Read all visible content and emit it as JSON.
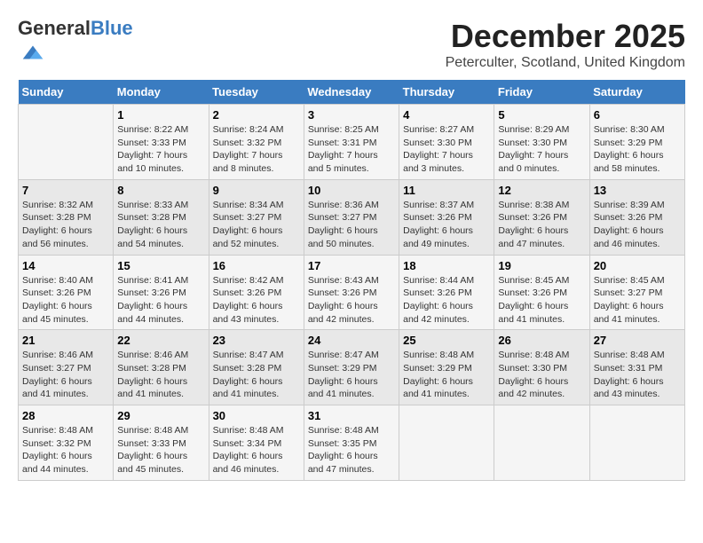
{
  "header": {
    "logo_general": "General",
    "logo_blue": "Blue",
    "month_title": "December 2025",
    "location": "Peterculter, Scotland, United Kingdom"
  },
  "days_of_week": [
    "Sunday",
    "Monday",
    "Tuesday",
    "Wednesday",
    "Thursday",
    "Friday",
    "Saturday"
  ],
  "weeks": [
    [
      {
        "day": "",
        "info": ""
      },
      {
        "day": "1",
        "info": "Sunrise: 8:22 AM\nSunset: 3:33 PM\nDaylight: 7 hours\nand 10 minutes."
      },
      {
        "day": "2",
        "info": "Sunrise: 8:24 AM\nSunset: 3:32 PM\nDaylight: 7 hours\nand 8 minutes."
      },
      {
        "day": "3",
        "info": "Sunrise: 8:25 AM\nSunset: 3:31 PM\nDaylight: 7 hours\nand 5 minutes."
      },
      {
        "day": "4",
        "info": "Sunrise: 8:27 AM\nSunset: 3:30 PM\nDaylight: 7 hours\nand 3 minutes."
      },
      {
        "day": "5",
        "info": "Sunrise: 8:29 AM\nSunset: 3:30 PM\nDaylight: 7 hours\nand 0 minutes."
      },
      {
        "day": "6",
        "info": "Sunrise: 8:30 AM\nSunset: 3:29 PM\nDaylight: 6 hours\nand 58 minutes."
      }
    ],
    [
      {
        "day": "7",
        "info": "Sunrise: 8:32 AM\nSunset: 3:28 PM\nDaylight: 6 hours\nand 56 minutes."
      },
      {
        "day": "8",
        "info": "Sunrise: 8:33 AM\nSunset: 3:28 PM\nDaylight: 6 hours\nand 54 minutes."
      },
      {
        "day": "9",
        "info": "Sunrise: 8:34 AM\nSunset: 3:27 PM\nDaylight: 6 hours\nand 52 minutes."
      },
      {
        "day": "10",
        "info": "Sunrise: 8:36 AM\nSunset: 3:27 PM\nDaylight: 6 hours\nand 50 minutes."
      },
      {
        "day": "11",
        "info": "Sunrise: 8:37 AM\nSunset: 3:26 PM\nDaylight: 6 hours\nand 49 minutes."
      },
      {
        "day": "12",
        "info": "Sunrise: 8:38 AM\nSunset: 3:26 PM\nDaylight: 6 hours\nand 47 minutes."
      },
      {
        "day": "13",
        "info": "Sunrise: 8:39 AM\nSunset: 3:26 PM\nDaylight: 6 hours\nand 46 minutes."
      }
    ],
    [
      {
        "day": "14",
        "info": "Sunrise: 8:40 AM\nSunset: 3:26 PM\nDaylight: 6 hours\nand 45 minutes."
      },
      {
        "day": "15",
        "info": "Sunrise: 8:41 AM\nSunset: 3:26 PM\nDaylight: 6 hours\nand 44 minutes."
      },
      {
        "day": "16",
        "info": "Sunrise: 8:42 AM\nSunset: 3:26 PM\nDaylight: 6 hours\nand 43 minutes."
      },
      {
        "day": "17",
        "info": "Sunrise: 8:43 AM\nSunset: 3:26 PM\nDaylight: 6 hours\nand 42 minutes."
      },
      {
        "day": "18",
        "info": "Sunrise: 8:44 AM\nSunset: 3:26 PM\nDaylight: 6 hours\nand 42 minutes."
      },
      {
        "day": "19",
        "info": "Sunrise: 8:45 AM\nSunset: 3:26 PM\nDaylight: 6 hours\nand 41 minutes."
      },
      {
        "day": "20",
        "info": "Sunrise: 8:45 AM\nSunset: 3:27 PM\nDaylight: 6 hours\nand 41 minutes."
      }
    ],
    [
      {
        "day": "21",
        "info": "Sunrise: 8:46 AM\nSunset: 3:27 PM\nDaylight: 6 hours\nand 41 minutes."
      },
      {
        "day": "22",
        "info": "Sunrise: 8:46 AM\nSunset: 3:28 PM\nDaylight: 6 hours\nand 41 minutes."
      },
      {
        "day": "23",
        "info": "Sunrise: 8:47 AM\nSunset: 3:28 PM\nDaylight: 6 hours\nand 41 minutes."
      },
      {
        "day": "24",
        "info": "Sunrise: 8:47 AM\nSunset: 3:29 PM\nDaylight: 6 hours\nand 41 minutes."
      },
      {
        "day": "25",
        "info": "Sunrise: 8:48 AM\nSunset: 3:29 PM\nDaylight: 6 hours\nand 41 minutes."
      },
      {
        "day": "26",
        "info": "Sunrise: 8:48 AM\nSunset: 3:30 PM\nDaylight: 6 hours\nand 42 minutes."
      },
      {
        "day": "27",
        "info": "Sunrise: 8:48 AM\nSunset: 3:31 PM\nDaylight: 6 hours\nand 43 minutes."
      }
    ],
    [
      {
        "day": "28",
        "info": "Sunrise: 8:48 AM\nSunset: 3:32 PM\nDaylight: 6 hours\nand 44 minutes."
      },
      {
        "day": "29",
        "info": "Sunrise: 8:48 AM\nSunset: 3:33 PM\nDaylight: 6 hours\nand 45 minutes."
      },
      {
        "day": "30",
        "info": "Sunrise: 8:48 AM\nSunset: 3:34 PM\nDaylight: 6 hours\nand 46 minutes."
      },
      {
        "day": "31",
        "info": "Sunrise: 8:48 AM\nSunset: 3:35 PM\nDaylight: 6 hours\nand 47 minutes."
      },
      {
        "day": "",
        "info": ""
      },
      {
        "day": "",
        "info": ""
      },
      {
        "day": "",
        "info": ""
      }
    ]
  ]
}
